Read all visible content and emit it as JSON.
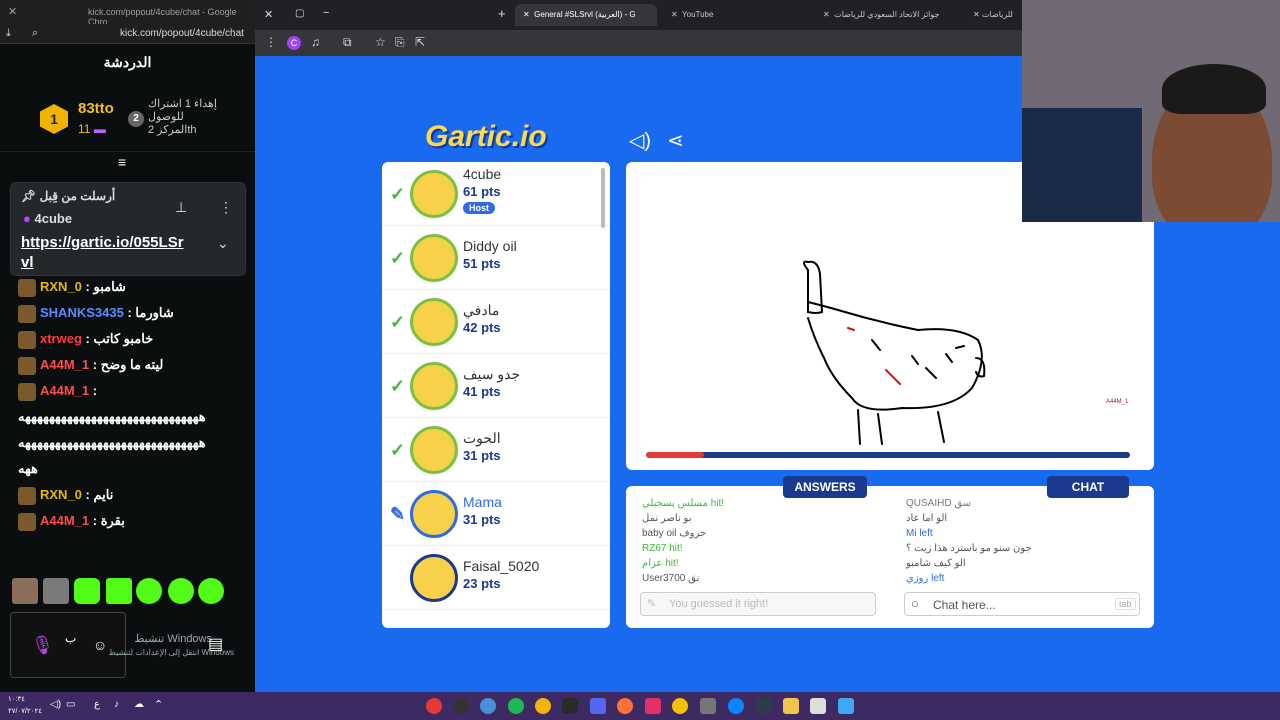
{
  "kick": {
    "window_title": "kick.com/popout/4cube/chat - Google Chro...",
    "address": "kick.com/popout/4cube/chat",
    "header": "الدردشة",
    "leaderboard": {
      "first_rank": "1",
      "first_name": "83tto",
      "first_count": "11",
      "second_text_line1": "إهداء 1 اشتراك",
      "second_text_line2": "للوصول",
      "second_text_line3": "المركز 2th",
      "second_rank": "2"
    },
    "pinned": {
      "label": "أرسلت من قِبل",
      "author": "4cube",
      "link_line1": "https://gartic.io/055LSr",
      "link_line2": "vl"
    },
    "messages": [
      {
        "user": "RXN_0",
        "text": "شامبو",
        "color": "#e6b800"
      },
      {
        "user": "SHANKS3435",
        "text": "شاورما",
        "color": "#5a8cff"
      },
      {
        "user": "xtrweg",
        "text": "خامبو كاتب",
        "color": "#ff3b3b"
      },
      {
        "user": "A44M_1",
        "text": "ليته ما وضح",
        "color": "#ff4d4d"
      },
      {
        "user": "A44M_1",
        "text": "",
        "color": "#ff4d4d"
      },
      {
        "user": "",
        "text": "ههههههههههههههههههههههههههههههه",
        "color": "#fff"
      },
      {
        "user": "",
        "text": "ههههههههههههههههههههههههههههههه",
        "color": "#fff"
      },
      {
        "user": "",
        "text": "ههه",
        "color": "#fff"
      },
      {
        "user": "RXN_0",
        "text": "نايم",
        "color": "#e6b800"
      },
      {
        "user": "A44M_1",
        "text": "بقرة",
        "color": "#ff4d4d"
      }
    ],
    "windows_activate_line1": "تنشيط Windows",
    "windows_activate_line2": "انتقل إلى الإعدادات لتنشيط Windows"
  },
  "browser": {
    "tabs": [
      {
        "label": "General #SLSrvl (العربية) - G"
      },
      {
        "label": "YouTube"
      },
      {
        "label": "جوائز الاتحاد السعودي للرياضات"
      },
      {
        "label": "للرياضات"
      }
    ]
  },
  "gartic": {
    "logo": "Gartic.io",
    "players": [
      {
        "name": "4cube",
        "pts": "61 pts",
        "host": "Host",
        "guessed": true
      },
      {
        "name": "Diddy oil",
        "pts": "51 pts",
        "guessed": true
      },
      {
        "name": "مادفي",
        "pts": "42 pts",
        "guessed": true
      },
      {
        "name": "جدو سيف",
        "pts": "41 pts",
        "guessed": true
      },
      {
        "name": "الحوت",
        "pts": "31 pts",
        "guessed": true
      },
      {
        "name": "Mama",
        "pts": "31 pts",
        "drawing": true
      },
      {
        "name": "Faisal_5020",
        "pts": "23 pts",
        "guessed": false
      }
    ],
    "drawer_tag": "A44M_1",
    "answers_title": "ANSWERS",
    "chat_title": "CHAT",
    "answers": [
      {
        "text": "مسلس يسجيلي hit!",
        "color": "#3cba3c"
      },
      {
        "text": "بو ناصر نمل",
        "color": "#555"
      },
      {
        "text": "baby oil خروف",
        "color": "#555"
      },
      {
        "text": "RZ67 hit!",
        "color": "#3cba3c"
      },
      {
        "text": "عزام hit!",
        "color": "#3cba3c"
      },
      {
        "text": "User3700 نق",
        "color": "#555"
      }
    ],
    "answers_placeholder": "You guessed it right!",
    "chat": [
      {
        "text": "QUSAIHD سق",
        "color": "#777"
      },
      {
        "text": "الو اما عاد",
        "color": "#555"
      },
      {
        "text": "Mi left",
        "color": "#2f6be0"
      },
      {
        "text": "جون سنو مو باسترد هذا زيت ؟",
        "color": "#555"
      },
      {
        "text": "الو كيف شامبو",
        "color": "#555"
      },
      {
        "text": "روزي left",
        "color": "#2f6be0"
      }
    ],
    "chat_placeholder": "Chat here...",
    "chat_tab_hint": "tab",
    "timer_fraction": 0.12
  },
  "taskbar": {
    "time": "١٠:٣٤",
    "date": "٢٧/٠٧/٢٠٢٤"
  }
}
